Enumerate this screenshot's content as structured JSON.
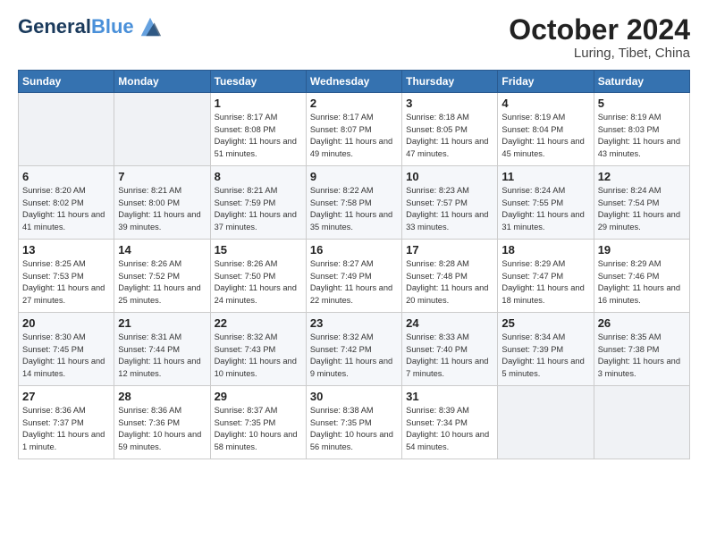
{
  "header": {
    "logo_line1": "General",
    "logo_line2": "Blue",
    "month": "October 2024",
    "location": "Luring, Tibet, China"
  },
  "weekdays": [
    "Sunday",
    "Monday",
    "Tuesday",
    "Wednesday",
    "Thursday",
    "Friday",
    "Saturday"
  ],
  "weeks": [
    [
      {
        "day": "",
        "text": ""
      },
      {
        "day": "",
        "text": ""
      },
      {
        "day": "1",
        "text": "Sunrise: 8:17 AM\nSunset: 8:08 PM\nDaylight: 11 hours and 51 minutes."
      },
      {
        "day": "2",
        "text": "Sunrise: 8:17 AM\nSunset: 8:07 PM\nDaylight: 11 hours and 49 minutes."
      },
      {
        "day": "3",
        "text": "Sunrise: 8:18 AM\nSunset: 8:05 PM\nDaylight: 11 hours and 47 minutes."
      },
      {
        "day": "4",
        "text": "Sunrise: 8:19 AM\nSunset: 8:04 PM\nDaylight: 11 hours and 45 minutes."
      },
      {
        "day": "5",
        "text": "Sunrise: 8:19 AM\nSunset: 8:03 PM\nDaylight: 11 hours and 43 minutes."
      }
    ],
    [
      {
        "day": "6",
        "text": "Sunrise: 8:20 AM\nSunset: 8:02 PM\nDaylight: 11 hours and 41 minutes."
      },
      {
        "day": "7",
        "text": "Sunrise: 8:21 AM\nSunset: 8:00 PM\nDaylight: 11 hours and 39 minutes."
      },
      {
        "day": "8",
        "text": "Sunrise: 8:21 AM\nSunset: 7:59 PM\nDaylight: 11 hours and 37 minutes."
      },
      {
        "day": "9",
        "text": "Sunrise: 8:22 AM\nSunset: 7:58 PM\nDaylight: 11 hours and 35 minutes."
      },
      {
        "day": "10",
        "text": "Sunrise: 8:23 AM\nSunset: 7:57 PM\nDaylight: 11 hours and 33 minutes."
      },
      {
        "day": "11",
        "text": "Sunrise: 8:24 AM\nSunset: 7:55 PM\nDaylight: 11 hours and 31 minutes."
      },
      {
        "day": "12",
        "text": "Sunrise: 8:24 AM\nSunset: 7:54 PM\nDaylight: 11 hours and 29 minutes."
      }
    ],
    [
      {
        "day": "13",
        "text": "Sunrise: 8:25 AM\nSunset: 7:53 PM\nDaylight: 11 hours and 27 minutes."
      },
      {
        "day": "14",
        "text": "Sunrise: 8:26 AM\nSunset: 7:52 PM\nDaylight: 11 hours and 25 minutes."
      },
      {
        "day": "15",
        "text": "Sunrise: 8:26 AM\nSunset: 7:50 PM\nDaylight: 11 hours and 24 minutes."
      },
      {
        "day": "16",
        "text": "Sunrise: 8:27 AM\nSunset: 7:49 PM\nDaylight: 11 hours and 22 minutes."
      },
      {
        "day": "17",
        "text": "Sunrise: 8:28 AM\nSunset: 7:48 PM\nDaylight: 11 hours and 20 minutes."
      },
      {
        "day": "18",
        "text": "Sunrise: 8:29 AM\nSunset: 7:47 PM\nDaylight: 11 hours and 18 minutes."
      },
      {
        "day": "19",
        "text": "Sunrise: 8:29 AM\nSunset: 7:46 PM\nDaylight: 11 hours and 16 minutes."
      }
    ],
    [
      {
        "day": "20",
        "text": "Sunrise: 8:30 AM\nSunset: 7:45 PM\nDaylight: 11 hours and 14 minutes."
      },
      {
        "day": "21",
        "text": "Sunrise: 8:31 AM\nSunset: 7:44 PM\nDaylight: 11 hours and 12 minutes."
      },
      {
        "day": "22",
        "text": "Sunrise: 8:32 AM\nSunset: 7:43 PM\nDaylight: 11 hours and 10 minutes."
      },
      {
        "day": "23",
        "text": "Sunrise: 8:32 AM\nSunset: 7:42 PM\nDaylight: 11 hours and 9 minutes."
      },
      {
        "day": "24",
        "text": "Sunrise: 8:33 AM\nSunset: 7:40 PM\nDaylight: 11 hours and 7 minutes."
      },
      {
        "day": "25",
        "text": "Sunrise: 8:34 AM\nSunset: 7:39 PM\nDaylight: 11 hours and 5 minutes."
      },
      {
        "day": "26",
        "text": "Sunrise: 8:35 AM\nSunset: 7:38 PM\nDaylight: 11 hours and 3 minutes."
      }
    ],
    [
      {
        "day": "27",
        "text": "Sunrise: 8:36 AM\nSunset: 7:37 PM\nDaylight: 11 hours and 1 minute."
      },
      {
        "day": "28",
        "text": "Sunrise: 8:36 AM\nSunset: 7:36 PM\nDaylight: 10 hours and 59 minutes."
      },
      {
        "day": "29",
        "text": "Sunrise: 8:37 AM\nSunset: 7:35 PM\nDaylight: 10 hours and 58 minutes."
      },
      {
        "day": "30",
        "text": "Sunrise: 8:38 AM\nSunset: 7:35 PM\nDaylight: 10 hours and 56 minutes."
      },
      {
        "day": "31",
        "text": "Sunrise: 8:39 AM\nSunset: 7:34 PM\nDaylight: 10 hours and 54 minutes."
      },
      {
        "day": "",
        "text": ""
      },
      {
        "day": "",
        "text": ""
      }
    ]
  ]
}
